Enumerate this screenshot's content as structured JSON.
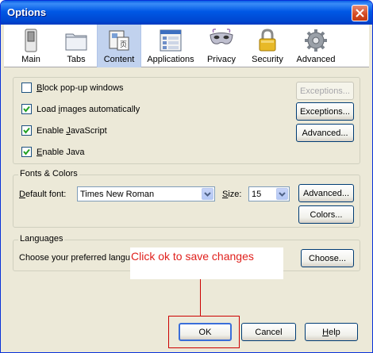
{
  "window": {
    "title": "Options"
  },
  "toolbar": {
    "items": [
      {
        "label": "Main",
        "icon": "main-switch-icon"
      },
      {
        "label": "Tabs",
        "icon": "tabs-folder-icon"
      },
      {
        "label": "Content",
        "icon": "content-page-icon",
        "selected": true
      },
      {
        "label": "Applications",
        "icon": "applications-grid-icon"
      },
      {
        "label": "Privacy",
        "icon": "privacy-mask-icon"
      },
      {
        "label": "Security",
        "icon": "security-lock-icon"
      },
      {
        "label": "Advanced",
        "icon": "advanced-gear-icon"
      }
    ]
  },
  "content": {
    "block_popups": {
      "label": "Block pop-up windows",
      "checked": false,
      "exceptions": "Exceptions..."
    },
    "load_images": {
      "label": "Load images automatically",
      "checked": true,
      "exceptions": "Exceptions..."
    },
    "javascript": {
      "label": "Enable JavaScript",
      "checked": true,
      "advanced": "Advanced..."
    },
    "java": {
      "label": "Enable Java",
      "checked": true
    }
  },
  "fonts": {
    "legend": "Fonts & Colors",
    "default_font_label": "Default font:",
    "default_font_value": "Times New Roman",
    "size_label": "Size:",
    "size_value": "15",
    "advanced": "Advanced...",
    "colors": "Colors..."
  },
  "languages": {
    "legend": "Languages",
    "prompt": "Choose your preferred langu",
    "choose": "Choose..."
  },
  "footer": {
    "ok": "OK",
    "cancel": "Cancel",
    "help": "Help"
  },
  "annotation": {
    "text": "Click ok to save changes",
    "color": "#e0201c"
  },
  "colors": {
    "title_bar": "#0054e3",
    "dialog_bg": "#ece9d8",
    "selected_tab": "#c1d2ee"
  }
}
